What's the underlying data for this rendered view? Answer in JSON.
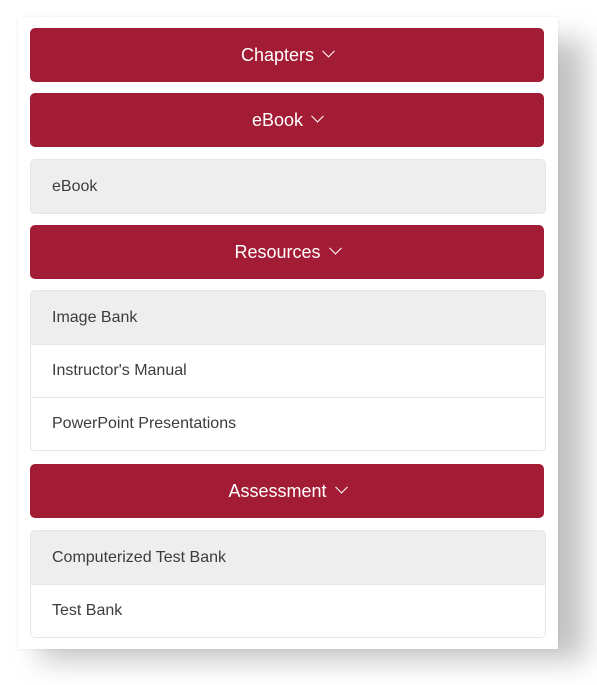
{
  "sections": [
    {
      "label": "Chapters",
      "items": []
    },
    {
      "label": "eBook",
      "items": [
        "eBook"
      ]
    },
    {
      "label": "Resources",
      "items": [
        "Image Bank",
        "Instructor's Manual",
        "PowerPoint Presentations"
      ]
    },
    {
      "label": "Assessment",
      "items": [
        "Computerized Test Bank",
        "Test Bank"
      ]
    }
  ],
  "colors": {
    "header_bg": "#a31c35",
    "header_text": "#ffffff",
    "item_shaded_bg": "#eeeeee",
    "item_text": "#3c3c3c"
  },
  "icons": {
    "section_toggle": "chevron-down-icon"
  }
}
